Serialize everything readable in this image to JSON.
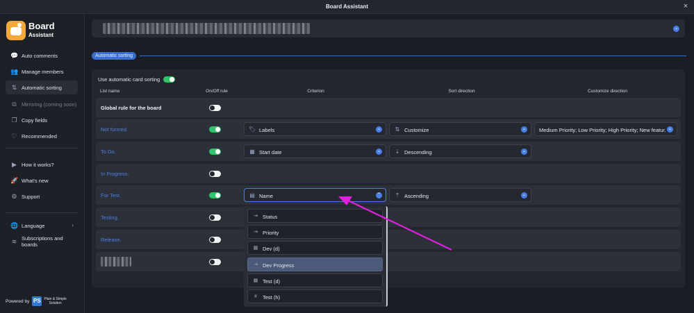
{
  "window": {
    "title": "Board Assistant",
    "close_icon": "×"
  },
  "logo": {
    "line1": "Board",
    "line2": "Assistant"
  },
  "sidebar": {
    "items": [
      {
        "label": "Auto comments",
        "icon": "💬"
      },
      {
        "label": "Manage members",
        "icon": "👥"
      },
      {
        "label": "Automatic sorting",
        "icon": "⇅"
      },
      {
        "label": "Mirroring (coming soon)",
        "icon": "⧉"
      },
      {
        "label": "Copy fields",
        "icon": "❐"
      },
      {
        "label": "Recommended",
        "icon": "♡"
      },
      {
        "label": "How it works?",
        "icon": "▶"
      },
      {
        "label": "What's new",
        "icon": "🚀"
      },
      {
        "label": "Support",
        "icon": "⚙"
      },
      {
        "label": "Language",
        "icon": "🌐"
      },
      {
        "label": "Subscriptions and boards",
        "icon": "≋"
      }
    ],
    "language_chevron": "›",
    "powered_by": "Powered by",
    "partner_badge": "PS",
    "partner_line1": "Plain & Simple",
    "partner_line2": "Solution"
  },
  "section": {
    "label": "Automatic sorting"
  },
  "panel": {
    "use_automatic_label": "Use automatic card sorting",
    "columns": {
      "list_name": "List name",
      "on_off": "On/Off rule",
      "criterion": "Criterion",
      "sort_direction": "Sort direction",
      "customize_direction": "Customize direction"
    },
    "rows": [
      {
        "name": "Global rule for the board",
        "on": false
      },
      {
        "name": "Not formed",
        "on": true,
        "criterion": "Labels",
        "direction": "Customize",
        "customize": "Medium Priority; Low Priority; High Priority; New featur..."
      },
      {
        "name": "To Do.",
        "on": true,
        "criterion": "Start date",
        "direction": "Descending"
      },
      {
        "name": "In Progress.",
        "on": false
      },
      {
        "name": "For Test.",
        "on": true,
        "criterion": "Name",
        "direction": "Ascending"
      },
      {
        "name": "Testing.",
        "on": false
      },
      {
        "name": "Release.",
        "on": false
      },
      {
        "name": "",
        "on": false
      }
    ]
  },
  "dropdown": {
    "options": [
      {
        "label": "Status",
        "icon": "⇥"
      },
      {
        "label": "Priority",
        "icon": "⇥"
      },
      {
        "label": "Dev (d)",
        "icon": "▦"
      },
      {
        "label": "Dev Progress",
        "icon": "⇥",
        "highlighted": true
      },
      {
        "label": "Test (d)",
        "icon": "▦"
      },
      {
        "label": "Test (h)",
        "icon": "#"
      }
    ]
  },
  "colors": {
    "accent": "#4a7fe6",
    "toggle_on": "#2fc46a",
    "annotation_arrow": "#e020e0"
  },
  "icons": {
    "chevron_down": "⌄",
    "chevron_up": "⌃",
    "labels": "🏷",
    "start_date": "▦",
    "name": "▤",
    "customize": "⇅",
    "descending": "⇣",
    "ascending": "⇡"
  }
}
